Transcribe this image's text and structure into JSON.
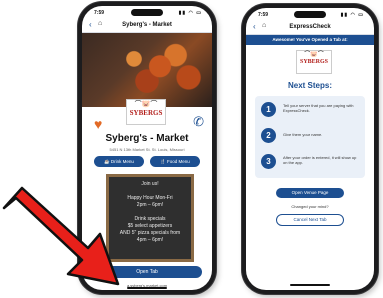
{
  "left_phone": {
    "status_time": "7:59",
    "nav_back": "‹",
    "nav_title": "Syberg's - Market",
    "logo_text": "SYBERGS",
    "venue_title": "Syberg's - Market",
    "venue_address": "5451 N 13th Market St. St. Louis, Missouri",
    "drink_menu_label": "☕ Drink Menu",
    "food_menu_label": "🍴 Food Menu",
    "chalkboard_lines": [
      "Join us!",
      "",
      "Happy Hour Mon-Fri",
      "2pm – 6pm!",
      "",
      "Drink specials",
      "$5 select appetizers",
      "AND 5\" pizza specials from",
      "4pm – 6pm!"
    ],
    "open_tab_label": "Open Tab",
    "url_text": "a.syberg's.market.com"
  },
  "right_phone": {
    "status_time": "7:59",
    "nav_back": "‹",
    "nav_title": "ExpressCheck",
    "banner_text": "Awesome! You've Opened a Tab at:",
    "logo_text": "SYBERGS",
    "steps_title": "Next Steps:",
    "steps": [
      {
        "num": "1",
        "text": "Tell your server that you are paying with ExpressCheck."
      },
      {
        "num": "2",
        "text": "Give them your name."
      },
      {
        "num": "3",
        "text": "After your order is entered, it will show up on the app."
      }
    ],
    "open_venue_label": "Open Venue Page",
    "changed_text": "Changed your mind?",
    "cancel_tab_label": "Cancel Next Tab"
  },
  "colors": {
    "brand_blue": "#1d4f91",
    "brand_red": "#b3201d",
    "arrow_red": "#e8201a"
  }
}
